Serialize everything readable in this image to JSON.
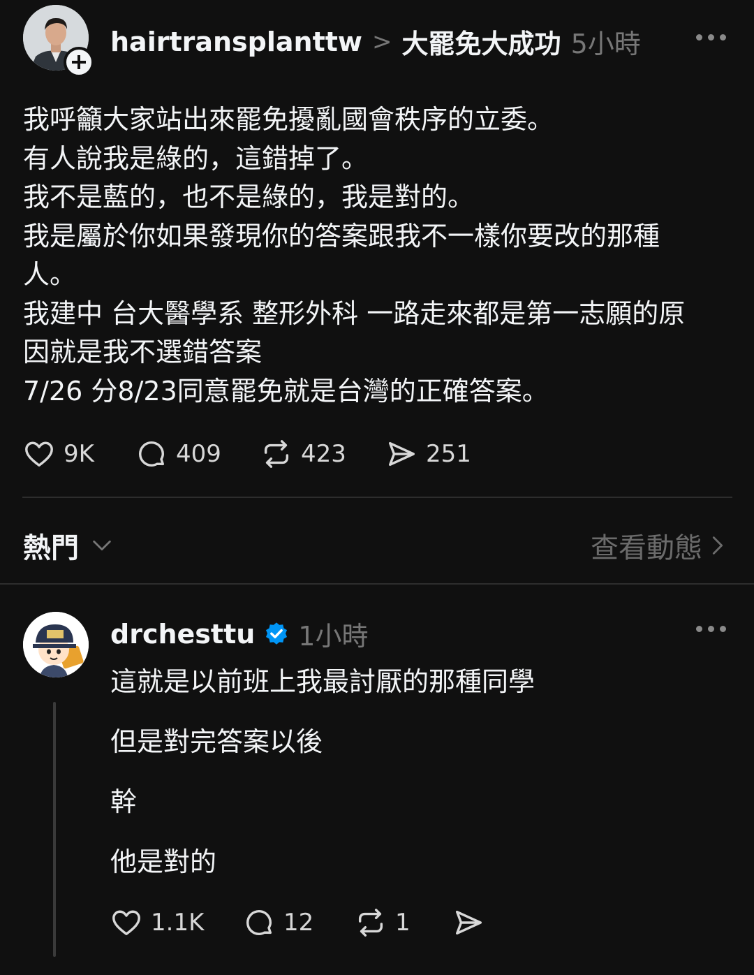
{
  "post": {
    "author": "hairtransplanttw",
    "breadcrumb_separator": ">",
    "topic": "大罷免大成功",
    "time": "5小時",
    "lines": [
      "我呼籲大家站出來罷免擾亂國會秩序的立委。",
      "有人說我是綠的，這錯掉了。",
      "我不是藍的，也不是綠的，我是對的。",
      "我是屬於你如果發現你的答案跟我不一樣你要改的那種",
      "人。",
      "我建中 台大醫學系 整形外科 一路走來都是第一志願的原",
      "因就是我不選錯答案",
      "7/26 分8/23同意罷免就是台灣的正確答案。"
    ],
    "likes": "9K",
    "comments": "409",
    "reposts": "423",
    "shares": "251"
  },
  "sort_bar": {
    "label": "熱門",
    "activity_link": "查看動態"
  },
  "reply": {
    "author": "drchesttu",
    "verified": true,
    "time": "1小時",
    "lines": [
      "這就是以前班上我最討厭的那種同學",
      "但是對完答案以後",
      "幹",
      "他是對的"
    ],
    "likes": "1.1K",
    "comments": "12",
    "reposts": "1"
  },
  "colors": {
    "background": "#101010",
    "text": "#f3f5f7",
    "muted": "#777777",
    "verified": "#0095f6"
  }
}
